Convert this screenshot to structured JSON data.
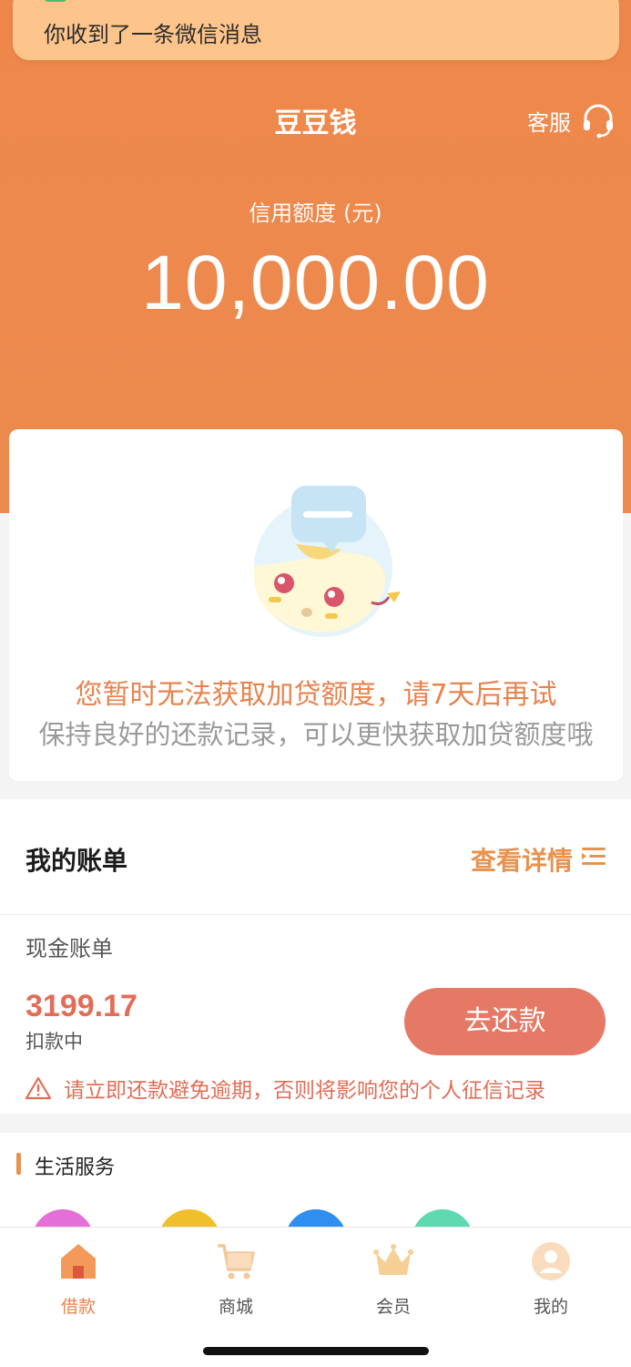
{
  "notification": {
    "text": "你收到了一条微信消息"
  },
  "header": {
    "title": "豆豆钱",
    "service_label": "客服",
    "credit_label": "信用额度 (元)",
    "credit_amount": "10,000.00"
  },
  "notice": {
    "main": "您暂时无法获取加贷额度，请7天后再试",
    "sub": "保持良好的还款记录，可以更快获取加贷额度哦"
  },
  "bill": {
    "title": "我的账单",
    "more_label": "查看详情",
    "cash_label": "现金账单",
    "cash_amount": "3199.17",
    "cash_status": "扣款中",
    "repay_label": "去还款",
    "warning": "请立即还款避免逾期，否则将影响您的个人征信记录"
  },
  "life_services": {
    "title": "生活服务",
    "circle_colors": [
      "#e46fd6",
      "#f0c02a",
      "#2f8ff0",
      "#5fd9b0"
    ]
  },
  "tabbar": {
    "items": [
      {
        "label": "借款",
        "icon": "home-icon",
        "active": true
      },
      {
        "label": "商城",
        "icon": "cart-icon",
        "active": false
      },
      {
        "label": "会员",
        "icon": "crown-icon",
        "active": false
      },
      {
        "label": "我的",
        "icon": "profile-icon",
        "active": false
      }
    ]
  },
  "colors": {
    "accent": "#ee884a",
    "repay_button": "#e67866",
    "warning": "#e26d56"
  }
}
